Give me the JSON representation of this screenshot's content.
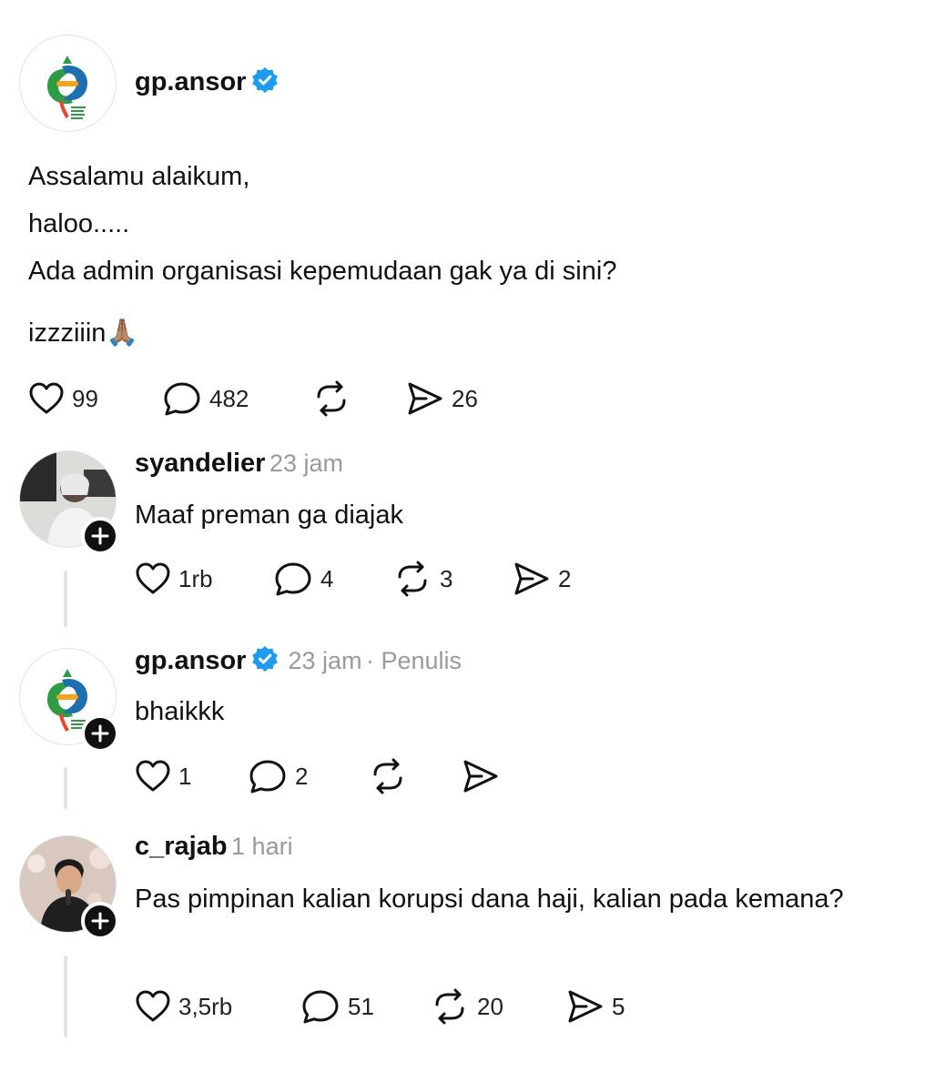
{
  "post": {
    "author": "gp.ansor",
    "lines": [
      "Assalamu alaikum,",
      "haloo.....",
      "Ada admin organisasi kepemudaan gak ya di sini?",
      "izzziiin🙏🏽"
    ],
    "likes": "99",
    "replies": "482",
    "shares": "26"
  },
  "comments": [
    {
      "author": "syandelier",
      "time": "23 jam",
      "text": "Maaf preman ga diajak",
      "likes": "1rb",
      "replies": "4",
      "reposts": "3",
      "shares": "2"
    },
    {
      "author": "gp.ansor",
      "time": "23 jam",
      "role": "· Penulis",
      "text": "bhaikkk",
      "likes": "1",
      "replies": "2"
    },
    {
      "author": "c_rajab",
      "time": "1 hari",
      "text": "Pas pimpinan kalian korupsi dana haji, kalian pada kemana?",
      "likes": "3,5rb",
      "replies": "51",
      "reposts": "20",
      "shares": "5"
    }
  ],
  "colors": {
    "verified": "#1d9bf0",
    "logo_green": "#2e9b45",
    "logo_blue": "#1e6fb0"
  }
}
